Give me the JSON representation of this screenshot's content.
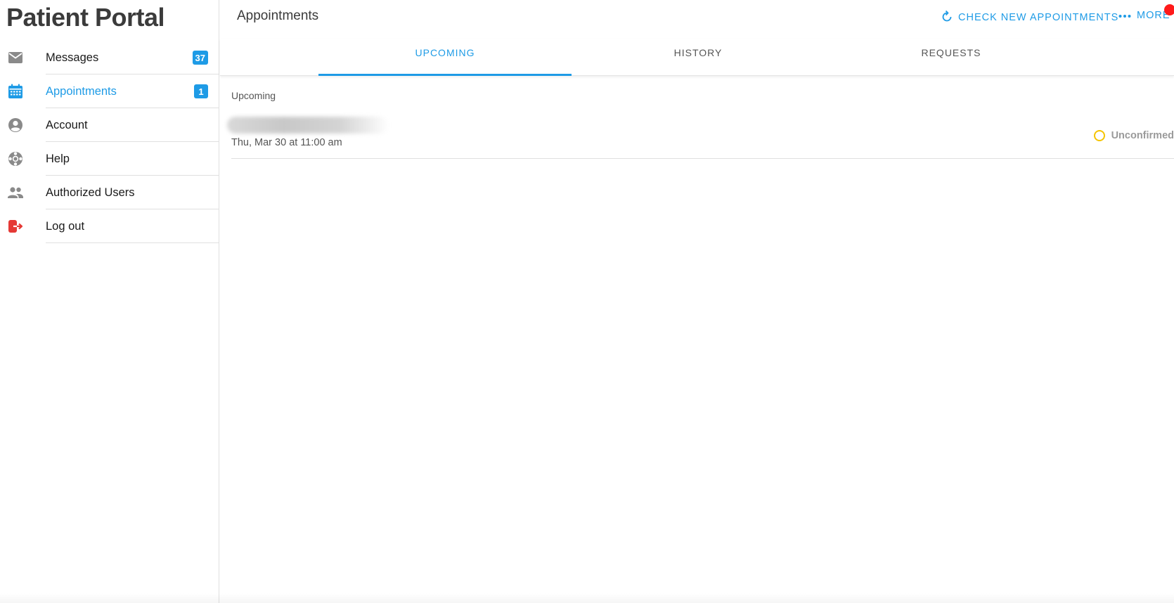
{
  "app": {
    "brand": "Patient Portal"
  },
  "sidebar": {
    "items": [
      {
        "label": "Messages",
        "badge": "37",
        "icon": "mail-icon"
      },
      {
        "label": "Appointments",
        "badge": "1",
        "icon": "calendar-icon"
      },
      {
        "label": "Account",
        "icon": "account-circle-icon"
      },
      {
        "label": "Help",
        "icon": "lifebuoy-icon"
      },
      {
        "label": "Authorized Users",
        "icon": "people-icon"
      },
      {
        "label": "Log out",
        "icon": "logout-icon"
      }
    ],
    "active_index": 1
  },
  "header": {
    "title": "Appointments",
    "check_label": "CHECK NEW APPOINTMENTS",
    "more_label": "MORE"
  },
  "tabs": [
    {
      "label": "UPCOMING",
      "active": true
    },
    {
      "label": "HISTORY",
      "active": false
    },
    {
      "label": "REQUESTS",
      "active": false
    }
  ],
  "upcoming": {
    "section_label": "Upcoming",
    "appointments": [
      {
        "date": "Thu, Mar 30 at 11:00 am",
        "status": "Unconfirmed"
      }
    ]
  },
  "colors": {
    "accent": "#1e9be6",
    "logout": "#e53935",
    "status_pending": "#f5c400",
    "notification": "#ff1a1a"
  }
}
